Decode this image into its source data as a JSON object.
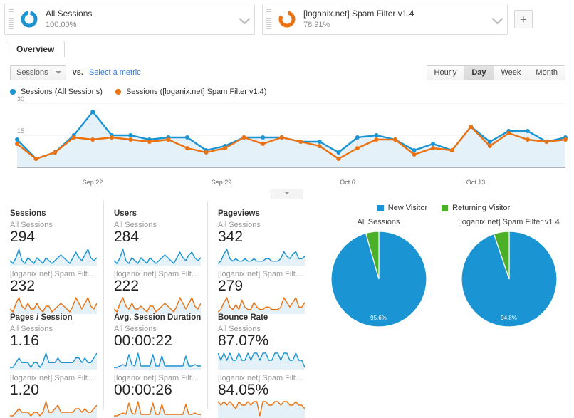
{
  "segments": [
    {
      "name": "All Sessions",
      "percent": "100.00%",
      "color": "#1a94d2",
      "icon": "donut-icon",
      "chevron": "chevron-down-icon"
    },
    {
      "name": "[loganix.net] Spam Filter v1.4",
      "percent": "78.91%",
      "color": "#ec7211",
      "icon": "donut-icon",
      "chevron": "chevron-down-icon"
    }
  ],
  "add_segment_label": "+",
  "tabs": [
    {
      "label": "Overview",
      "active": true
    }
  ],
  "metric_selector": {
    "primary_metric": "Sessions",
    "vs_label": "vs.",
    "select_metric_link": "Select a metric"
  },
  "granularity": {
    "options": [
      "Hourly",
      "Day",
      "Week",
      "Month"
    ],
    "selected": "Day"
  },
  "chart_legend": [
    {
      "label": "Sessions (All Sessions)",
      "color": "#1a94d2"
    },
    {
      "label": "Sessions ([loganix.net] Spam Filter v1.4)",
      "color": "#ec7211"
    }
  ],
  "chart_data": {
    "type": "line",
    "title": "Sessions over time",
    "xlabel": "",
    "ylabel": "Sessions",
    "ylim": [
      0,
      30
    ],
    "yticks": [
      "30",
      "15"
    ],
    "ytick_values": [
      30,
      15
    ],
    "grid": true,
    "legend_position": "top-left",
    "xtick_labels": [
      "Sep 22",
      "Sep 29",
      "Oct 6",
      "Oct 13"
    ],
    "xtick_indices": [
      4,
      11,
      18,
      25
    ],
    "x": [
      1,
      2,
      3,
      4,
      5,
      6,
      7,
      8,
      9,
      10,
      11,
      12,
      13,
      14,
      15,
      16,
      17,
      18,
      19,
      20,
      21,
      22,
      23,
      24,
      25,
      26,
      27,
      28,
      29,
      30
    ],
    "series": [
      {
        "name": "Sessions (All Sessions)",
        "color": "#1a94d2",
        "values": [
          13,
          4,
          7,
          15,
          26,
          15,
          15,
          13,
          14,
          14,
          8,
          10,
          14,
          14,
          14,
          12,
          12,
          7,
          14,
          15,
          13,
          8,
          11,
          8,
          19,
          12,
          17,
          17,
          12,
          14
        ]
      },
      {
        "name": "Sessions ([loganix.net] Spam Filter v1.4)",
        "color": "#ec7211",
        "values": [
          11,
          4,
          7,
          14,
          13,
          14,
          13,
          12,
          13,
          9,
          7,
          9,
          14,
          11,
          14,
          12,
          10,
          4,
          9,
          13,
          13,
          6,
          9,
          8,
          19,
          10,
          16,
          13,
          12,
          13
        ]
      }
    ]
  },
  "metric_cards": [
    {
      "title": "Sessions",
      "all_label": "All Sessions",
      "all_value": "294",
      "seg_label": "[loganix.net] Spam Filter ...",
      "seg_value": "232",
      "spark_all": [
        5,
        4,
        6,
        9,
        5,
        4,
        6,
        5,
        4,
        6,
        5,
        4,
        6,
        5,
        4,
        5,
        6,
        7,
        6,
        5,
        4,
        6,
        8,
        6,
        5,
        7,
        9,
        6,
        5,
        6
      ],
      "spark_seg": [
        4,
        3,
        6,
        8,
        5,
        4,
        6,
        4,
        4,
        6,
        4,
        3,
        5,
        5,
        3,
        4,
        5,
        6,
        5,
        4,
        3,
        5,
        8,
        6,
        4,
        6,
        8,
        5,
        4,
        6
      ]
    },
    {
      "title": "Users",
      "all_label": "All Sessions",
      "all_value": "284",
      "seg_label": "[loganix.net] Spam Filter ...",
      "seg_value": "222",
      "spark_all": [
        5,
        4,
        6,
        9,
        5,
        4,
        6,
        5,
        4,
        6,
        5,
        4,
        6,
        5,
        4,
        5,
        6,
        7,
        6,
        5,
        4,
        6,
        8,
        6,
        5,
        7,
        8,
        6,
        5,
        6
      ],
      "spark_seg": [
        4,
        3,
        6,
        8,
        5,
        4,
        6,
        4,
        4,
        5,
        4,
        3,
        5,
        5,
        3,
        4,
        5,
        6,
        5,
        4,
        3,
        5,
        8,
        6,
        4,
        6,
        8,
        5,
        4,
        6
      ]
    },
    {
      "title": "Pageviews",
      "all_label": "All Sessions",
      "all_value": "342",
      "seg_label": "[loganix.net] Spam Filter ...",
      "seg_value": "279",
      "spark_all": [
        4,
        5,
        8,
        10,
        6,
        5,
        6,
        5,
        5,
        6,
        5,
        5,
        6,
        5,
        5,
        5,
        6,
        6,
        5,
        5,
        5,
        6,
        9,
        7,
        6,
        8,
        9,
        6,
        6,
        7
      ],
      "spark_seg": [
        3,
        4,
        7,
        9,
        5,
        4,
        6,
        4,
        8,
        5,
        4,
        4,
        7,
        5,
        4,
        4,
        5,
        5,
        4,
        4,
        4,
        5,
        9,
        7,
        5,
        7,
        9,
        5,
        5,
        7
      ]
    },
    {
      "title": "Pages / Session",
      "all_label": "All Sessions",
      "all_value": "1.16",
      "seg_label": "[loganix.net] Spam Filter ...",
      "seg_value": "1.20",
      "spark_all": [
        4,
        4,
        5,
        6,
        5,
        5,
        5,
        4,
        5,
        5,
        4,
        5,
        7,
        5,
        5,
        5,
        6,
        5,
        5,
        5,
        5,
        5,
        6,
        6,
        5,
        6,
        5,
        5,
        6,
        7
      ],
      "spark_seg": [
        4,
        4,
        5,
        6,
        5,
        5,
        5,
        4,
        5,
        5,
        4,
        5,
        8,
        5,
        5,
        6,
        7,
        5,
        5,
        5,
        5,
        5,
        6,
        6,
        5,
        6,
        5,
        5,
        6,
        7
      ]
    },
    {
      "title": "Avg. Session Duration",
      "all_label": "All Sessions",
      "all_value": "00:00:22",
      "seg_label": "[loganix.net] Spam Filter ...",
      "seg_value": "00:00:26",
      "spark_all": [
        1,
        1,
        2,
        3,
        2,
        10,
        3,
        2,
        11,
        2,
        2,
        2,
        2,
        10,
        2,
        2,
        9,
        2,
        2,
        2,
        2,
        2,
        2,
        2,
        9,
        2,
        2,
        3,
        2,
        2
      ],
      "spark_seg": [
        1,
        1,
        2,
        3,
        2,
        10,
        3,
        2,
        11,
        2,
        2,
        2,
        2,
        10,
        2,
        2,
        9,
        2,
        2,
        2,
        2,
        2,
        2,
        2,
        9,
        2,
        2,
        3,
        2,
        2
      ]
    },
    {
      "title": "Bounce Rate",
      "all_label": "All Sessions",
      "all_value": "87.07%",
      "seg_label": "[loganix.net] Spam Filter ...",
      "seg_value": "84.05%",
      "spark_all": [
        8,
        7,
        8,
        7,
        8,
        7,
        7,
        8,
        7,
        7,
        8,
        7,
        8,
        8,
        7,
        8,
        8,
        7,
        7,
        8,
        8,
        7,
        8,
        8,
        7,
        7,
        8,
        7,
        7,
        6
      ],
      "spark_seg": [
        8,
        7,
        8,
        7,
        8,
        7,
        6,
        8,
        7,
        7,
        8,
        7,
        8,
        8,
        4,
        8,
        8,
        7,
        7,
        8,
        8,
        7,
        8,
        8,
        7,
        7,
        8,
        7,
        7,
        6
      ]
    }
  ],
  "visitor_chart": {
    "legend": [
      {
        "label": "New Visitor",
        "color": "#1a94d2"
      },
      {
        "label": "Returning Visitor",
        "color": "#4caf28"
      }
    ],
    "charts": [
      {
        "type": "pie",
        "title": "All Sessions",
        "categories": [
          "New Visitor",
          "Returning Visitor"
        ],
        "values": [
          95.6,
          4.4
        ],
        "label": "95.6%"
      },
      {
        "type": "pie",
        "title": "[loganix.net] Spam Filter v1.4",
        "categories": [
          "New Visitor",
          "Returning Visitor"
        ],
        "values": [
          94.8,
          5.2
        ],
        "label": "94.8%"
      }
    ]
  },
  "colors": {
    "blue": "#1a94d2",
    "orange": "#ec7211",
    "green": "#4caf28",
    "area_fill": "#e4f1f8",
    "link": "#2b7bd4"
  }
}
